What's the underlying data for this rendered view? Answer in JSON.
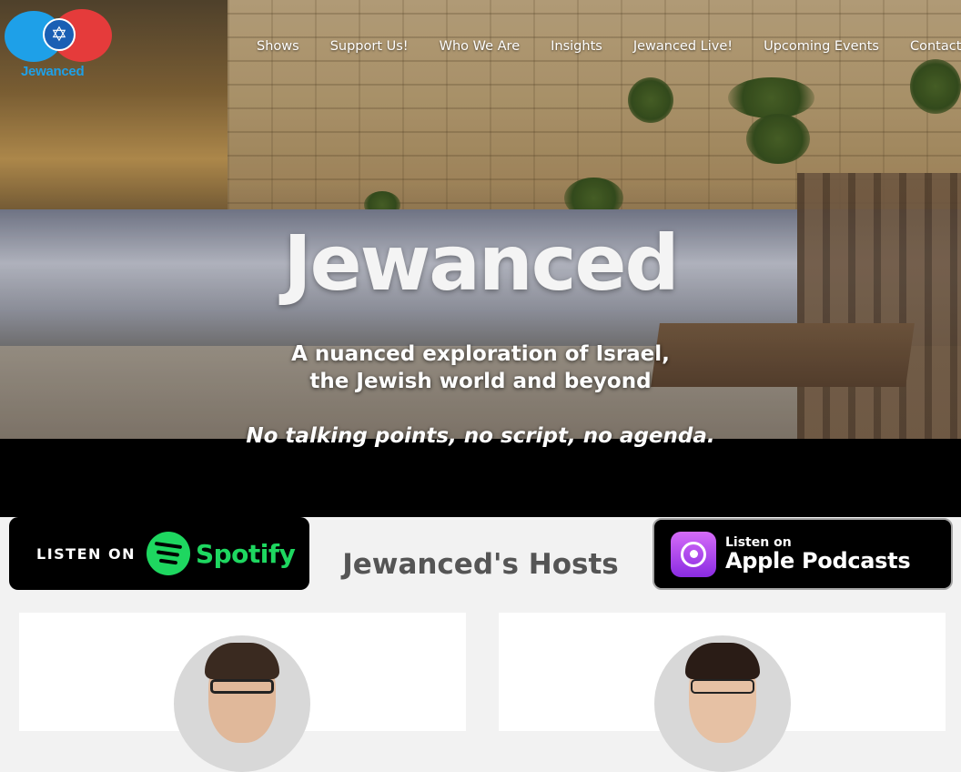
{
  "site": {
    "logo_text": "Jewanced"
  },
  "nav": {
    "items": [
      "Shows",
      "Support Us!",
      "Who We Are",
      "Insights",
      "Jewanced Live!",
      "Upcoming Events",
      "Contact"
    ]
  },
  "hero": {
    "title": "Jewanced",
    "subtitle_line1": "A nuanced exploration of Israel,",
    "subtitle_line2": "the Jewish world and beyond",
    "tagline": "No talking points, no script, no agenda."
  },
  "badges": {
    "spotify_listen": "LISTEN ON",
    "spotify_brand": "Spotify",
    "apple_listen": "Listen on",
    "apple_brand": "Apple Podcasts"
  },
  "hosts": {
    "title": "Jewanced's Hosts"
  },
  "colors": {
    "logo_blue": "#1ea0e8",
    "logo_red": "#e53b3b",
    "spotify_green": "#1ed760",
    "apple_purple": "#8a2be2"
  }
}
